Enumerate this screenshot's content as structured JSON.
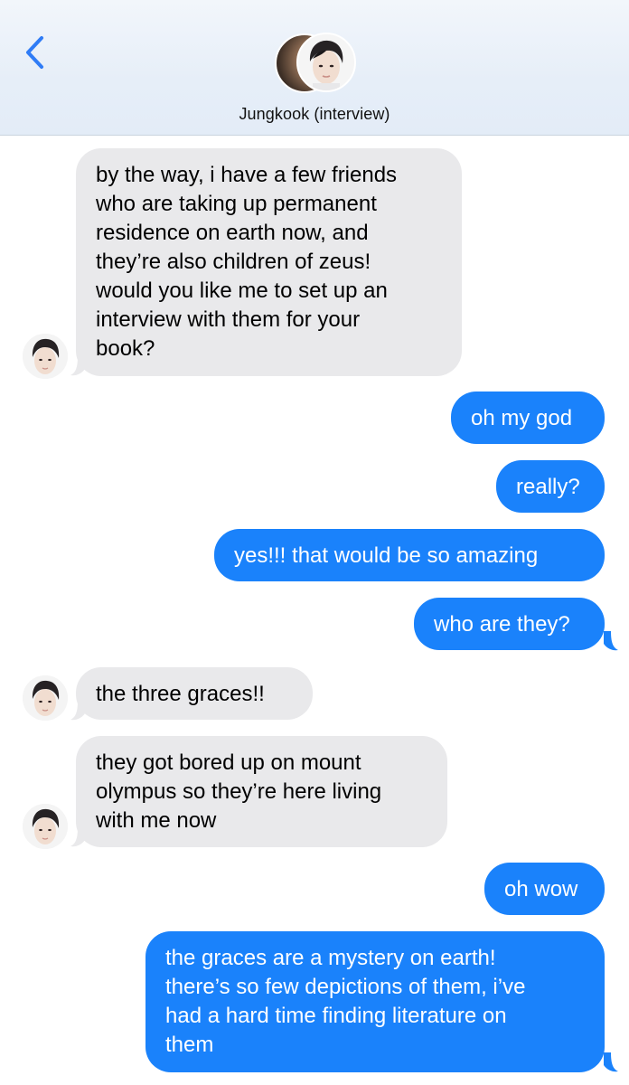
{
  "header": {
    "contact_name": "Jungkook (interview)",
    "back_icon": "chevron-left-icon",
    "accent": "#2f7cf6"
  },
  "messages": [
    {
      "side": "received",
      "text": "by the way, i have a few friends\nwho are taking up permanent\nresidence on earth now, and\nthey’re also children of zeus!\nwould you like me to set up an\ninterview with them for your\nbook?"
    },
    {
      "side": "sent",
      "text": "oh my god"
    },
    {
      "side": "sent",
      "text": "really?"
    },
    {
      "side": "sent",
      "text": "yes!!! that would be so amazing"
    },
    {
      "side": "sent",
      "text": "who are they?"
    },
    {
      "side": "received",
      "text": "the three graces!!"
    },
    {
      "side": "received",
      "text": "they got bored up on mount\nolympus so they’re here living\nwith me now"
    },
    {
      "side": "sent",
      "text": "oh wow"
    },
    {
      "side": "sent",
      "text": "the graces are a mystery on earth!\nthere’s so few depictions of them, i’ve\nhad a hard time finding literature on\nthem"
    }
  ],
  "colors": {
    "sent_bubble": "#1a82fb",
    "received_bubble": "#e9e9eb"
  }
}
